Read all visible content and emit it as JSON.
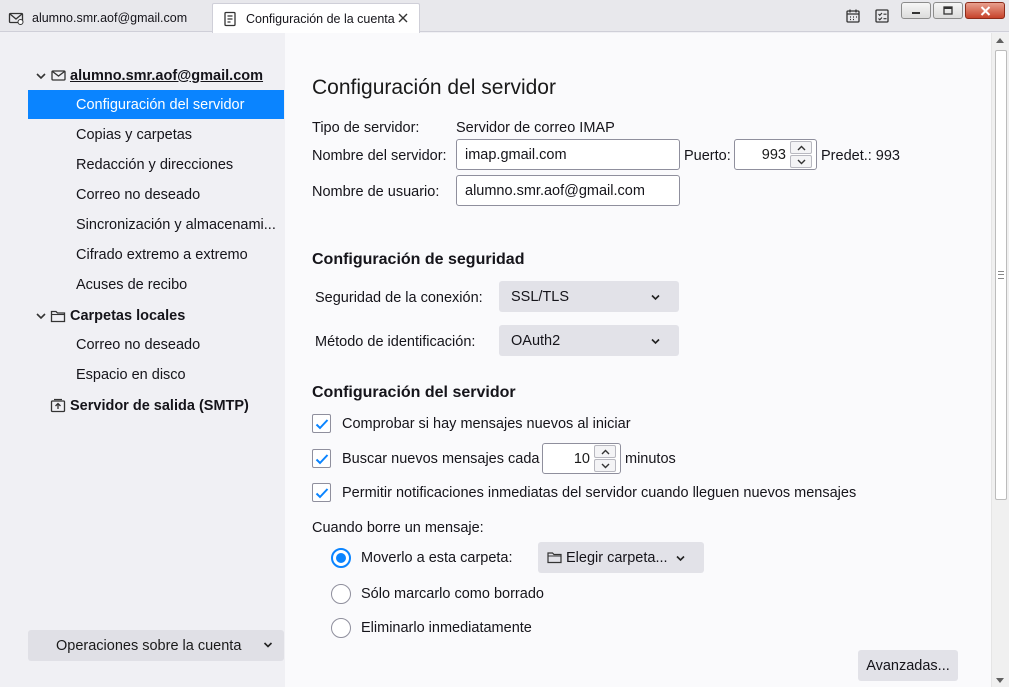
{
  "tabs": [
    {
      "label": "alumno.smr.aof@gmail.com",
      "icon": "mail-icon"
    },
    {
      "label": "Configuración de la cuenta",
      "icon": "document-icon"
    }
  ],
  "toolbar_icons": [
    "calendar-icon",
    "tasks-icon"
  ],
  "sidebar": {
    "account": "alumno.smr.aof@gmail.com",
    "account_items": [
      "Configuración del servidor",
      "Copias y carpetas",
      "Redacción y direcciones",
      "Correo no deseado",
      "Sincronización y almacenami...",
      "Cifrado extremo a extremo",
      "Acuses de recibo"
    ],
    "local_folders": "Carpetas locales",
    "local_items": [
      "Correo no deseado",
      "Espacio en disco"
    ],
    "smtp": "Servidor de salida (SMTP)",
    "operations": "Operaciones sobre la cuenta"
  },
  "main": {
    "title": "Configuración del servidor",
    "server_type_label": "Tipo de servidor:",
    "server_type_value": "Servidor de correo IMAP",
    "server_name_label": "Nombre del servidor:",
    "server_name_value": "imap.gmail.com",
    "port_label": "Puerto:",
    "port_value": "993",
    "port_default": "Predet.: 993",
    "username_label": "Nombre de usuario:",
    "username_value": "alumno.smr.aof@gmail.com",
    "security_heading": "Configuración de seguridad",
    "conn_security_label": "Seguridad de la conexión:",
    "conn_security_value": "SSL/TLS",
    "auth_method_label": "Método de identificación:",
    "auth_method_value": "OAuth2",
    "server_settings_heading": "Configuración del servidor",
    "check_startup": "Comprobar si hay mensajes nuevos al iniciar",
    "check_every": "Buscar nuevos mensajes cada",
    "check_every_value": "10",
    "minutes": "minutos",
    "allow_push": "Permitir notificaciones inmediatas del servidor cuando lleguen nuevos mensajes",
    "delete_label": "Cuando borre un mensaje:",
    "move_to_folder": "Moverlo a esta carpeta:",
    "choose_folder": "Elegir carpeta...",
    "mark_deleted": "Sólo marcarlo como borrado",
    "delete_immediately": "Eliminarlo inmediatamente",
    "advanced": "Avanzadas..."
  }
}
